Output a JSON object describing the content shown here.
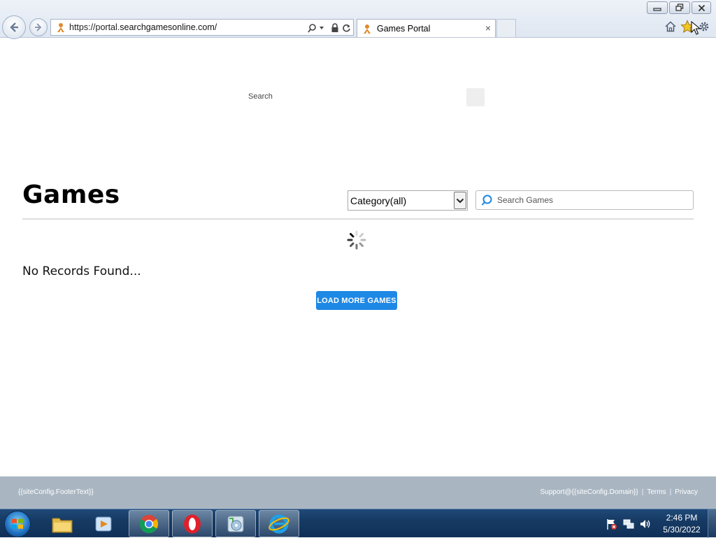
{
  "browser": {
    "url_prefix": "https://portal.",
    "url_domain": "searchgamesonline.com/",
    "tab_title": "Games Portal",
    "tab_close": "×"
  },
  "page": {
    "search_label": "Search",
    "title": "Games",
    "category_select": {
      "selected": "Category(all)"
    },
    "search_games": {
      "placeholder": "Search Games",
      "value": ""
    },
    "no_records": "No Records Found...",
    "load_more_label": "LOAD MORE GAMES"
  },
  "footer": {
    "left_text": "{{siteConfig.FooterText}}",
    "support": "Support@{{siteConfig.Domain}}",
    "sep1": "|",
    "terms": "Terms",
    "sep2": "|",
    "privacy": "Privacy"
  },
  "taskbar": {
    "time": "2:46 PM",
    "date": "5/30/2022",
    "apps": [
      "explorer-icon",
      "media-player-icon",
      "chrome-icon",
      "opera-icon",
      "media-center-icon",
      "internet-explorer-icon"
    ]
  },
  "colors": {
    "accent_button": "#1e88e5",
    "footer_bg": "#a9b6c2",
    "search_icon": "#1e88e5"
  }
}
